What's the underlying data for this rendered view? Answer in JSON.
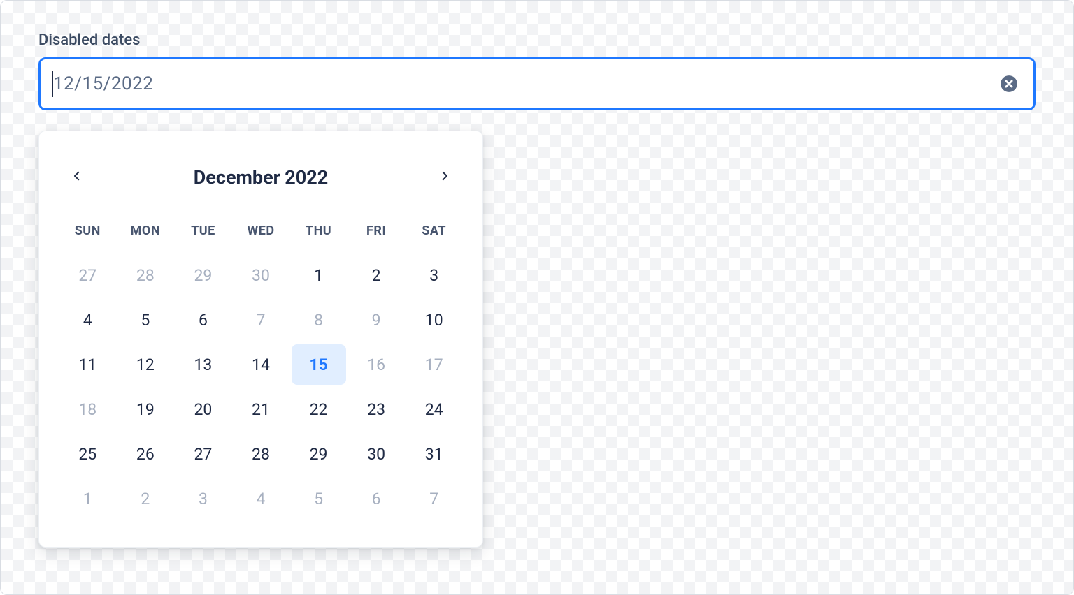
{
  "field": {
    "label": "Disabled dates",
    "value": "12/15/2022"
  },
  "calendar": {
    "title": "December 2022",
    "dow": [
      "SUN",
      "MON",
      "TUE",
      "WED",
      "THU",
      "FRI",
      "SAT"
    ],
    "days": [
      {
        "n": "27",
        "state": "muted"
      },
      {
        "n": "28",
        "state": "muted"
      },
      {
        "n": "29",
        "state": "muted"
      },
      {
        "n": "30",
        "state": "muted"
      },
      {
        "n": "1",
        "state": "normal"
      },
      {
        "n": "2",
        "state": "normal"
      },
      {
        "n": "3",
        "state": "normal"
      },
      {
        "n": "4",
        "state": "normal"
      },
      {
        "n": "5",
        "state": "normal"
      },
      {
        "n": "6",
        "state": "normal"
      },
      {
        "n": "7",
        "state": "disabled"
      },
      {
        "n": "8",
        "state": "disabled"
      },
      {
        "n": "9",
        "state": "disabled"
      },
      {
        "n": "10",
        "state": "normal"
      },
      {
        "n": "11",
        "state": "normal"
      },
      {
        "n": "12",
        "state": "normal"
      },
      {
        "n": "13",
        "state": "normal"
      },
      {
        "n": "14",
        "state": "normal"
      },
      {
        "n": "15",
        "state": "selected"
      },
      {
        "n": "16",
        "state": "disabled"
      },
      {
        "n": "17",
        "state": "disabled"
      },
      {
        "n": "18",
        "state": "disabled"
      },
      {
        "n": "19",
        "state": "normal"
      },
      {
        "n": "20",
        "state": "normal"
      },
      {
        "n": "21",
        "state": "normal"
      },
      {
        "n": "22",
        "state": "normal"
      },
      {
        "n": "23",
        "state": "normal"
      },
      {
        "n": "24",
        "state": "normal"
      },
      {
        "n": "25",
        "state": "normal"
      },
      {
        "n": "26",
        "state": "normal"
      },
      {
        "n": "27",
        "state": "normal"
      },
      {
        "n": "28",
        "state": "normal"
      },
      {
        "n": "29",
        "state": "normal"
      },
      {
        "n": "30",
        "state": "normal"
      },
      {
        "n": "31",
        "state": "normal"
      },
      {
        "n": "1",
        "state": "muted"
      },
      {
        "n": "2",
        "state": "muted"
      },
      {
        "n": "3",
        "state": "muted"
      },
      {
        "n": "4",
        "state": "muted"
      },
      {
        "n": "5",
        "state": "muted"
      },
      {
        "n": "6",
        "state": "muted"
      },
      {
        "n": "7",
        "state": "muted"
      }
    ]
  }
}
